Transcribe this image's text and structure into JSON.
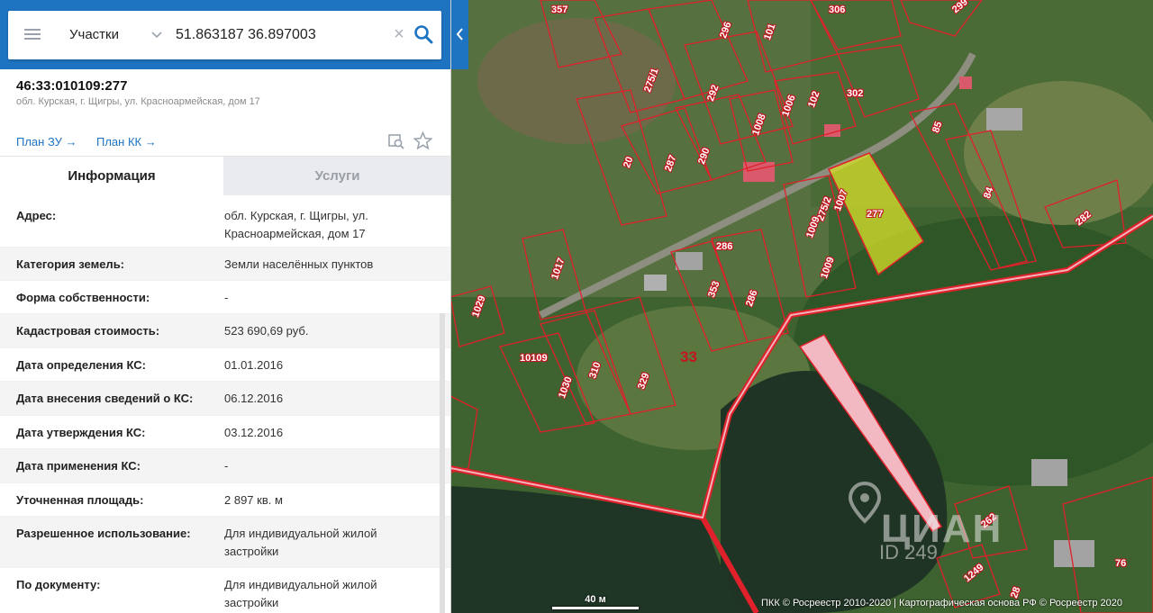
{
  "search": {
    "layer": "Участки",
    "query": "51.863187 36.897003"
  },
  "parcel": {
    "cad_number": "46:33:010109:277",
    "address_short": "обл. Курская, г. Щигры, ул. Красноармейская, дом 17",
    "plan_zu": "План ЗУ →",
    "plan_kk": "План КК →"
  },
  "tabs": {
    "info": "Информация",
    "services": "Услуги"
  },
  "info_rows": [
    {
      "label": "Адрес:",
      "value": "обл. Курская, г. Щигры, ул. Красноармейская, дом 17"
    },
    {
      "label": "Категория земель:",
      "value": "Земли населённых пунктов"
    },
    {
      "label": "Форма собственности:",
      "value": "-"
    },
    {
      "label": "Кадастровая стоимость:",
      "value": "523 690,69 руб."
    },
    {
      "label": "Дата определения КС:",
      "value": "01.01.2016"
    },
    {
      "label": "Дата внесения сведений о КС:",
      "value": "06.12.2016"
    },
    {
      "label": "Дата утверждения КС:",
      "value": "03.12.2016"
    },
    {
      "label": "Дата применения КС:",
      "value": "-"
    },
    {
      "label": "Уточненная площадь:",
      "value": "2 897 кв. м"
    },
    {
      "label": "Разрешенное использование:",
      "value": "Для индивидуальной жилой застройки"
    },
    {
      "label": "По документу:",
      "value": "Для индивидуальной жилой застройки"
    }
  ],
  "map": {
    "parcel_labels": [
      "357",
      "306",
      "299",
      "296",
      "101",
      "275/1",
      "292",
      "1006",
      "102",
      "302",
      "85",
      "1008",
      "20",
      "287",
      "290",
      "277",
      "84",
      "1007",
      "275/2",
      "1009",
      "286",
      "282",
      "1017",
      "1029",
      "353",
      "286",
      "1009",
      "33",
      "10109",
      "310",
      "329",
      "1030",
      "262",
      "1249",
      "76",
      "28"
    ],
    "scale_label": "40 м",
    "attribution": "ПКК © Росреестр 2010-2020 | Картографическая основа РФ © Росреестр 2020",
    "watermark_text": "ЦИАН",
    "watermark_id": "ID 249"
  },
  "colors": {
    "accent": "#1f74c2",
    "parcel_border": "#e0202a",
    "selected_parcel": "#d8e02a"
  }
}
